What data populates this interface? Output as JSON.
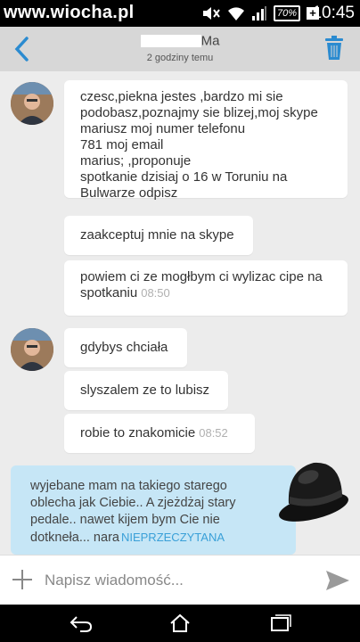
{
  "status_bar": {
    "watermark": "www.wiocha.pl",
    "battery": "70%",
    "time": "10:45"
  },
  "header": {
    "contact_name_suffix": "Ma",
    "last_seen": "2 godziny temu"
  },
  "messages": [
    {
      "text": "czesc,piekna jestes ,bardzo mi sie\npodobasz,poznajmy sie blizej,moj skype\nmariusz            moj numer telefonu\n781               moj email\nmarius;                        ,proponuje\nspotkanie dzisiaj o 16 w Toruniu na\nBulwarze odpisz",
      "time": ""
    },
    {
      "text": "zaakceptuj mnie na skype",
      "time": ""
    },
    {
      "text": "powiem ci ze mogłbym ci wylizac cipe na\nspotkaniu",
      "time": "08:50"
    },
    {
      "text": "gdybys chciała",
      "time": ""
    },
    {
      "text": "slyszalem ze to lubisz",
      "time": ""
    },
    {
      "text": "robie to znakomicie",
      "time": "08:52"
    }
  ],
  "reply": {
    "text": "wyjebane mam na takiego starego\noblecha jak Ciebie.. A  zjeżdżaj stary\npedale..  nawet kijem bym Cie nie\ndotkneła... nara",
    "status": "NIEPRZECZYTANA"
  },
  "composer": {
    "placeholder": "Napisz wiadomość..."
  },
  "icons": {
    "back": "chevron-left-icon",
    "trash": "trash-icon",
    "plus": "plus-icon",
    "send": "send-icon"
  },
  "colors": {
    "header_bg": "#d7d7d7",
    "accent": "#2b8bd0",
    "reply_bubble": "#c6e6f6",
    "status_blue": "#3aa0d8"
  }
}
